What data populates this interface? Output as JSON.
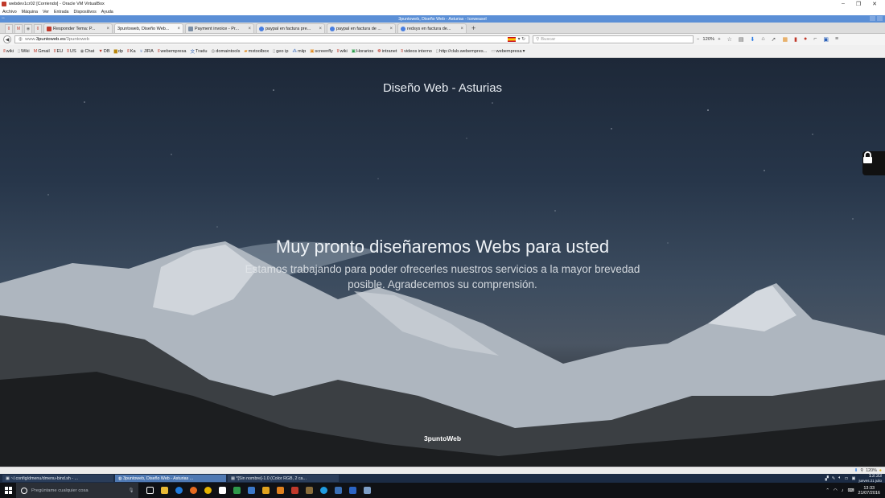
{
  "vbox": {
    "title": "webdev1cr02 [Corriendo] - Oracle VM VirtualBox",
    "menu": [
      "Archivo",
      "Máquina",
      "Ver",
      "Entrada",
      "Dispositivos",
      "Ayuda"
    ]
  },
  "firefox": {
    "window_title": "3puntoweb, Diseño Web - Asturias - Iceweasel",
    "tabs": [
      {
        "label": "Responder Tema: P..."
      },
      {
        "label": "3puntoweb, Diseño Web..."
      },
      {
        "label": "Payment invoice - Pr..."
      },
      {
        "label": "paypal en factura pre..."
      },
      {
        "label": "paypal en factura de ..."
      },
      {
        "label": "redsys en factura de..."
      }
    ],
    "url_prefix": "www.",
    "url_host": "3puntoweb.es",
    "url_path": "/3puntoweb",
    "search_placeholder": "Buscar",
    "zoom": "120%",
    "bookmarks": [
      "wiki",
      "Wiki",
      "Gmail",
      "EU",
      "US",
      "Chat",
      "DB",
      "dp",
      "Ka",
      "JIRA",
      "webempresa",
      "Tradu",
      "domaintools",
      "mxtoolbox",
      "geo ip",
      "miip",
      "screenfly",
      "wiki",
      "Horarios",
      "intranet",
      "videos interno",
      "http://club.webempres...",
      "webempresa"
    ]
  },
  "page": {
    "title": "Diseño Web - Asturias",
    "heading": "Muy pronto diseñaremos Webs para usted",
    "text": "Estamos trabajando para poder ofrecerles nuestros servicios a la mayor brevedad posible. Agradecemos su comprensión.",
    "footer": "3puntoWeb"
  },
  "statusbar": {
    "zoom": "120%"
  },
  "taskbar": {
    "tasks": [
      {
        "label": "~/.config/dmenu/dmenu-bind.sh - ..."
      },
      {
        "label": "3puntoweb, Diseño Web - Asturias ..."
      },
      {
        "label": "*[Sin nombre]-1.0 (Color RGB, 2 ca..."
      }
    ],
    "time": "13:33",
    "date": "jueves 21 julio"
  },
  "windows": {
    "search_placeholder": "Pregúntame cualquier cosa",
    "time": "13:33",
    "date": "21/07/2016"
  }
}
